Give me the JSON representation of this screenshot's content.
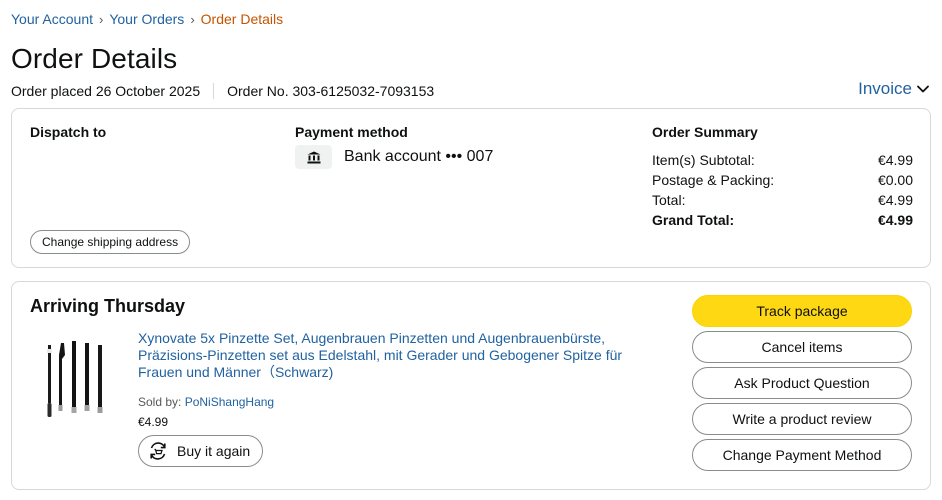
{
  "breadcrumb": {
    "items": [
      "Your Account",
      "Your Orders"
    ],
    "current": "Order Details",
    "separator": "›"
  },
  "page": {
    "title": "Order Details",
    "order_placed": "Order placed 26 October 2025",
    "order_number": "Order No. 303-6125032-7093153",
    "invoice_label": "Invoice"
  },
  "dispatch": {
    "title": "Dispatch to",
    "change_address_label": "Change shipping address"
  },
  "payment": {
    "title": "Payment method",
    "method": "Bank account ••• 007",
    "icon": "bank-icon"
  },
  "summary": {
    "title": "Order Summary",
    "rows": [
      {
        "label": "Item(s) Subtotal:",
        "value": "€4.99"
      },
      {
        "label": "Postage & Packing:",
        "value": "€0.00"
      },
      {
        "label": "Total:",
        "value": "€4.99"
      },
      {
        "label": "Grand Total:",
        "value": "€4.99"
      }
    ]
  },
  "shipment": {
    "status": "Arriving Thursday",
    "product": {
      "title": "Xynovate 5x Pinzette Set, Augenbrauen Pinzetten und Augenbrauenbürste, Präzisions-Pinzetten set aus Edelstahl, mit Gerader und Gebogener Spitze für Frauen und Männer（Schwarz)",
      "sold_by_label": "Sold by:",
      "seller": "PoNiShangHang",
      "price": "€4.99",
      "buy_again_label": "Buy it again"
    },
    "actions": {
      "track": "Track package",
      "cancel": "Cancel items",
      "ask": "Ask Product Question",
      "review": "Write a product review",
      "change_payment": "Change Payment Method"
    }
  },
  "colors": {
    "link": "#2162a1",
    "current_crumb": "#c45500",
    "primary_button": "#ffd814",
    "border": "#d5d9d9"
  }
}
